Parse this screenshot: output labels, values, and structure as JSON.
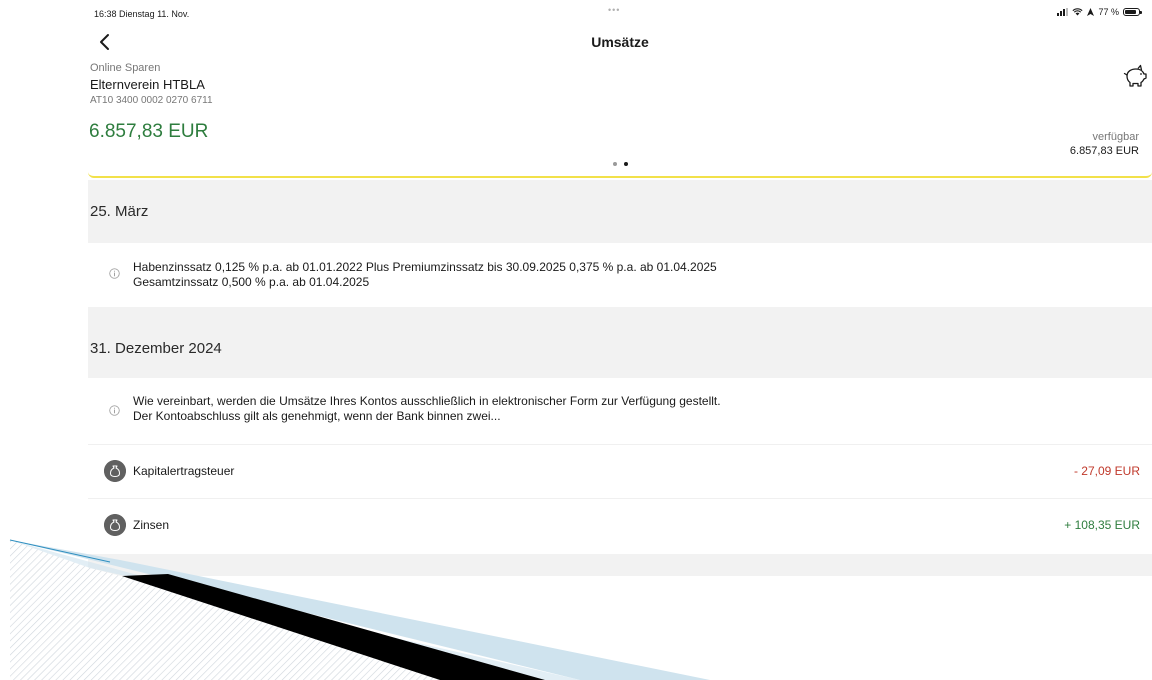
{
  "status": {
    "time": "16:38",
    "date": "Dienstag 11. Nov.",
    "dots": "•••",
    "battery": "77 %"
  },
  "nav": {
    "title": "Umsätze"
  },
  "account": {
    "type": "Online Sparen",
    "name": "Elternverein HTBLA",
    "iban": "AT10 3400 0002 0270 6711",
    "balance": "6.857,83 EUR",
    "available_label": "verfügbar",
    "available_value": "6.857,83 EUR"
  },
  "sections": [
    {
      "date": "25. März",
      "info": [
        "Habenzinssatz 0,125 %  p.a. ab 01.01.2022 Plus Premiumzinssatz bis 30.09.2025 0,375 %  p.a. ab 01.04.2025",
        "Gesamtzinssatz 0,500 %  p.a. ab 01.04.2025"
      ]
    },
    {
      "date": "31. Dezember 2024",
      "info": [
        "Wie vereinbart, werden die Umsätze Ihres Kontos ausschließlich in elektronischer Form zur Verfügung gestellt.",
        "Der Kontoabschluss gilt als genehmigt, wenn der Bank binnen zwei..."
      ],
      "transactions": [
        {
          "label": "Kapitalertragsteuer",
          "amount": "- 27,09 EUR"
        },
        {
          "label": "Zinsen",
          "amount": "+ 108,35 EUR"
        }
      ]
    }
  ],
  "colors": {
    "positive": "#2e7d3e",
    "negative": "#c0392b",
    "accent_border": "#f2e14a",
    "section_bg": "#f2f2f2"
  }
}
